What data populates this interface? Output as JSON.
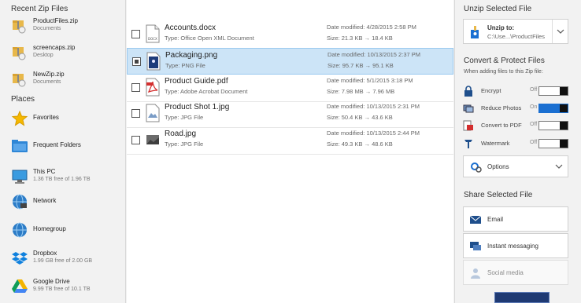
{
  "left_pane": {
    "recent_title": "Recent Zip Files",
    "recent": [
      {
        "name": "ProductFiles.zip",
        "location": "Documents"
      },
      {
        "name": "screencaps.zip",
        "location": "Desktop"
      },
      {
        "name": "NewZip.zip",
        "location": "Documents"
      }
    ],
    "places_title": "Places",
    "places": [
      {
        "name": "Favorites",
        "detail": ""
      },
      {
        "name": "Frequent Folders",
        "detail": ""
      },
      {
        "name": "This PC",
        "detail": "1.36 TB free of 1.96 TB"
      },
      {
        "name": "Network",
        "detail": ""
      },
      {
        "name": "Homegroup",
        "detail": ""
      },
      {
        "name": "Dropbox",
        "detail": "1.99 GB free of 2.00 GB"
      },
      {
        "name": "Google Drive",
        "detail": "9.99 TB free of 10.1 TB"
      }
    ]
  },
  "files": [
    {
      "name": "Accounts.docx",
      "type": "Type: Office Open XML Document",
      "date": "Date modified: 4/28/2015 2:58 PM",
      "size": "Size: 21.3 KB → 18.4 KB",
      "icon": "docx-icon",
      "selected": false
    },
    {
      "name": "Packaging.png",
      "type": "Type: PNG File",
      "date": "Date modified: 10/13/2015 2:37 PM",
      "size": "Size: 95.7 KB → 95.1 KB",
      "icon": "png-icon",
      "selected": true
    },
    {
      "name": "Product Guide.pdf",
      "type": "Type: Adobe Acrobat Document",
      "date": "Date modified: 5/1/2015 3:18 PM",
      "size": "Size: 7.98 MB → 7.96 MB",
      "icon": "pdf-icon",
      "selected": false
    },
    {
      "name": "Product Shot 1.jpg",
      "type": "Type: JPG File",
      "date": "Date modified: 10/13/2015 2:31 PM",
      "size": "Size: 50.4 KB → 43.6 KB",
      "icon": "jpg-icon",
      "selected": false
    },
    {
      "name": "Road.jpg",
      "type": "Type: JPG File",
      "date": "Date modified: 10/13/2015 2:44 PM",
      "size": "Size: 49.3 KB → 48.6 KB",
      "icon": "jpg-icon",
      "selected": false
    }
  ],
  "right_pane": {
    "unzip_title": "Unzip Selected File",
    "unzip_to_label": "Unzip to:",
    "unzip_path": "C:\\Use...\\ProductFiles",
    "convert_title": "Convert & Protect Files",
    "convert_hint": "When adding files to this Zip file:",
    "toggles": [
      {
        "label": "Encrypt",
        "state": "Off",
        "on": false
      },
      {
        "label": "Reduce Photos",
        "state": "On",
        "on": true
      },
      {
        "label": "Convert to PDF",
        "state": "Off",
        "on": false
      },
      {
        "label": "Watermark",
        "state": "Off",
        "on": false
      }
    ],
    "options_label": "Options",
    "share_title": "Share Selected File",
    "share": [
      {
        "label": "Email"
      },
      {
        "label": "Instant messaging"
      },
      {
        "label": "Social media"
      }
    ]
  },
  "colors": {
    "accent": "#1a6fd1",
    "selection": "#cce4f7"
  }
}
